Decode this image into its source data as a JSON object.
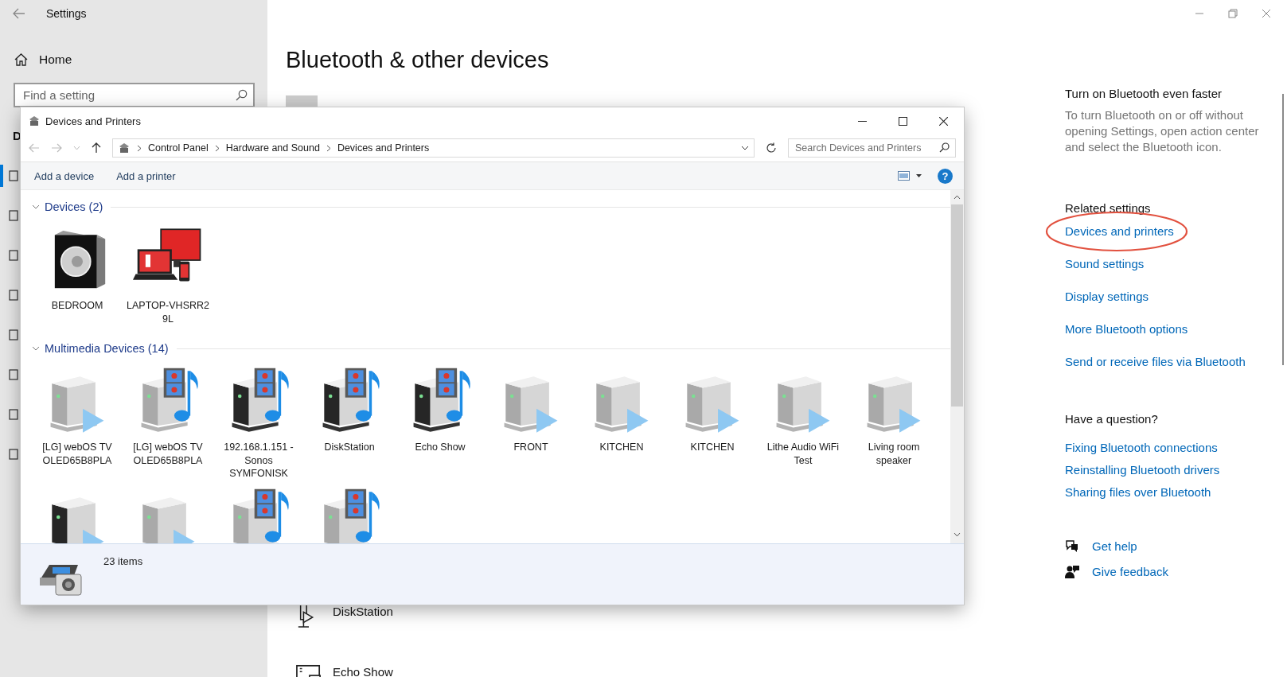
{
  "settings": {
    "title": "Settings",
    "home": "Home",
    "search": {
      "placeholder": "Find a setting"
    },
    "section_heading": "D",
    "nav_items": [
      {
        "selected": true
      },
      {
        "selected": false
      },
      {
        "selected": false
      },
      {
        "selected": false
      },
      {
        "selected": false
      },
      {
        "selected": false
      },
      {
        "selected": false
      },
      {
        "selected": false
      }
    ]
  },
  "page": {
    "title": "Bluetooth & other devices",
    "devices": [
      {
        "kind": "player",
        "name": "DiskStation"
      },
      {
        "kind": "screen",
        "name": "Echo Show"
      }
    ]
  },
  "related": {
    "tip_title": "Turn on Bluetooth even faster",
    "tip_text": "To turn Bluetooth on or off without opening Settings, open action center and select the Bluetooth icon.",
    "related_heading": "Related settings",
    "related_links": [
      {
        "label": "Devices and printers",
        "circled": true
      },
      {
        "label": "Sound settings",
        "circled": false
      },
      {
        "label": "Display settings",
        "circled": false
      },
      {
        "label": "More Bluetooth options",
        "circled": false
      },
      {
        "label": "Send or receive files via Bluetooth",
        "circled": false
      }
    ],
    "question_heading": "Have a question?",
    "help_links": [
      "Fixing Bluetooth connections",
      "Reinstalling Bluetooth drivers",
      "Sharing files over Bluetooth"
    ],
    "support": [
      {
        "kind": "help",
        "label": "Get help"
      },
      {
        "kind": "feedback",
        "label": "Give feedback"
      }
    ]
  },
  "devices_window": {
    "title": "Devices and Printers",
    "breadcrumb": [
      "Control Panel",
      "Hardware and Sound",
      "Devices and Printers"
    ],
    "search": {
      "placeholder": "Search Devices and Printers"
    },
    "toolbar": [
      "Add a device",
      "Add a printer"
    ],
    "help_button": "?",
    "groups": [
      {
        "title": "Devices (2)",
        "expanded": true,
        "items": [
          {
            "kind": "speaker",
            "label": "BEDROOM"
          },
          {
            "kind": "computer",
            "label": "LAPTOP-VHSRR29L"
          }
        ]
      },
      {
        "title": "Multimedia Devices (14)",
        "expanded": true,
        "items": [
          {
            "kind": "renderer",
            "label": "[LG] webOS TV OLED65B8PLA"
          },
          {
            "kind": "mediaserver",
            "label": "[LG] webOS TV OLED65B8PLA"
          },
          {
            "kind": "darkmediaserver",
            "label": "192.168.1.151 - Sonos SYMFONISK"
          },
          {
            "kind": "darkmediaserver",
            "label": "DiskStation"
          },
          {
            "kind": "darkmediaserver",
            "label": "Echo Show"
          },
          {
            "kind": "renderer",
            "label": "FRONT"
          },
          {
            "kind": "renderer",
            "label": "KITCHEN"
          },
          {
            "kind": "renderer",
            "label": "KITCHEN"
          },
          {
            "kind": "renderer",
            "label": "Lithe Audio WiFi Test"
          },
          {
            "kind": "renderer",
            "label": "Living room speaker"
          },
          {
            "kind": "darkrenderer"
          },
          {
            "kind": "renderer"
          },
          {
            "kind": "mediaserver"
          },
          {
            "kind": "mediaserver"
          }
        ]
      }
    ],
    "status": "23 items"
  }
}
